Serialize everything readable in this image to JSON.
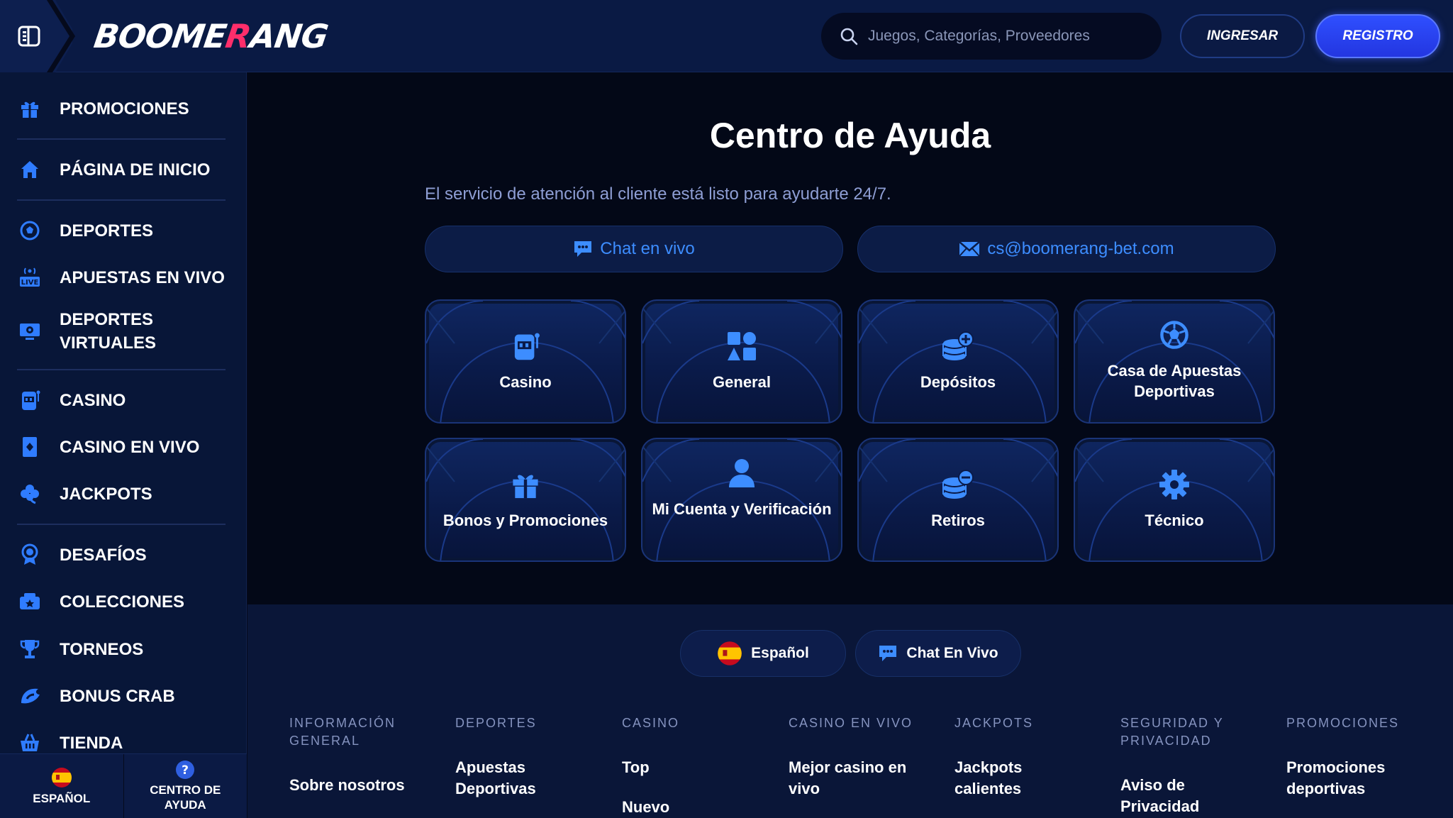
{
  "header": {
    "logo_text_a": "BOOME",
    "logo_text_r": "R",
    "logo_text_b": "ANG",
    "search_placeholder": "Juegos, Categorías, Proveedores",
    "login_label": "INGRESAR",
    "register_label": "REGISTRO"
  },
  "sidebar": {
    "items": [
      {
        "label": "PROMOCIONES",
        "icon": "gift-icon"
      },
      {
        "label": "PÁGINA DE INICIO",
        "icon": "home-icon"
      },
      {
        "label": "DEPORTES",
        "icon": "soccer-ball-icon"
      },
      {
        "label": "APUESTAS EN VIVO",
        "icon": "live-icon"
      },
      {
        "label": "DEPORTES VIRTUALES",
        "icon": "virtual-sports-icon"
      },
      {
        "label": "CASINO",
        "icon": "slot-machine-icon"
      },
      {
        "label": "CASINO EN VIVO",
        "icon": "card-icon"
      },
      {
        "label": "JACKPOTS",
        "icon": "clover-icon"
      },
      {
        "label": "DESAFÍOS",
        "icon": "medal-icon"
      },
      {
        "label": "COLECCIONES",
        "icon": "collection-icon"
      },
      {
        "label": "TORNEOS",
        "icon": "trophy-icon"
      },
      {
        "label": "BONUS CRAB",
        "icon": "crab-icon"
      },
      {
        "label": "TIENDA",
        "icon": "basket-icon"
      }
    ],
    "bottom": {
      "language_label": "ESPAÑOL",
      "help_label": "CENTRO DE AYUDA"
    }
  },
  "main": {
    "title": "Centro de Ayuda",
    "subtitle": "El servicio de atención al cliente está listo para ayudarte 24/7.",
    "chat_label": "Chat en vivo",
    "email_label": "cs@boomerang-bet.com",
    "cards": [
      {
        "label": "Casino",
        "icon": "slot-machine-icon"
      },
      {
        "label": "General",
        "icon": "shapes-icon"
      },
      {
        "label": "Depósitos",
        "icon": "coins-plus-icon"
      },
      {
        "label": "Casa de Apuestas Deportivas",
        "icon": "soccer-ball-icon"
      },
      {
        "label": "Bonos y Promociones",
        "icon": "gift-icon"
      },
      {
        "label": "Mi Cuenta y Verificación",
        "icon": "user-icon"
      },
      {
        "label": "Retiros",
        "icon": "coins-minus-icon"
      },
      {
        "label": "Técnico",
        "icon": "gear-icon"
      }
    ]
  },
  "footer": {
    "language_label": "Español",
    "chat_label": "Chat En Vivo",
    "columns": [
      {
        "heading": "INFORMACIÓN GENERAL",
        "links": [
          "Sobre nosotros"
        ]
      },
      {
        "heading": "DEPORTES",
        "links": [
          "Apuestas Deportivas"
        ]
      },
      {
        "heading": "CASINO",
        "links": [
          "Top",
          "Nuevo"
        ]
      },
      {
        "heading": "CASINO EN VIVO",
        "links": [
          "Mejor casino en vivo"
        ]
      },
      {
        "heading": "JACKPOTS",
        "links": [
          "Jackpots calientes"
        ]
      },
      {
        "heading": "SEGURIDAD Y PRIVACIDAD",
        "links": [
          "Aviso de Privacidad"
        ]
      },
      {
        "heading": "PROMOCIONES",
        "links": [
          "Promociones deportivas"
        ]
      }
    ]
  },
  "colors": {
    "accent": "#3d8dff",
    "brand_blue": "#2f4fff",
    "logo_red": "#ff2e6b"
  }
}
